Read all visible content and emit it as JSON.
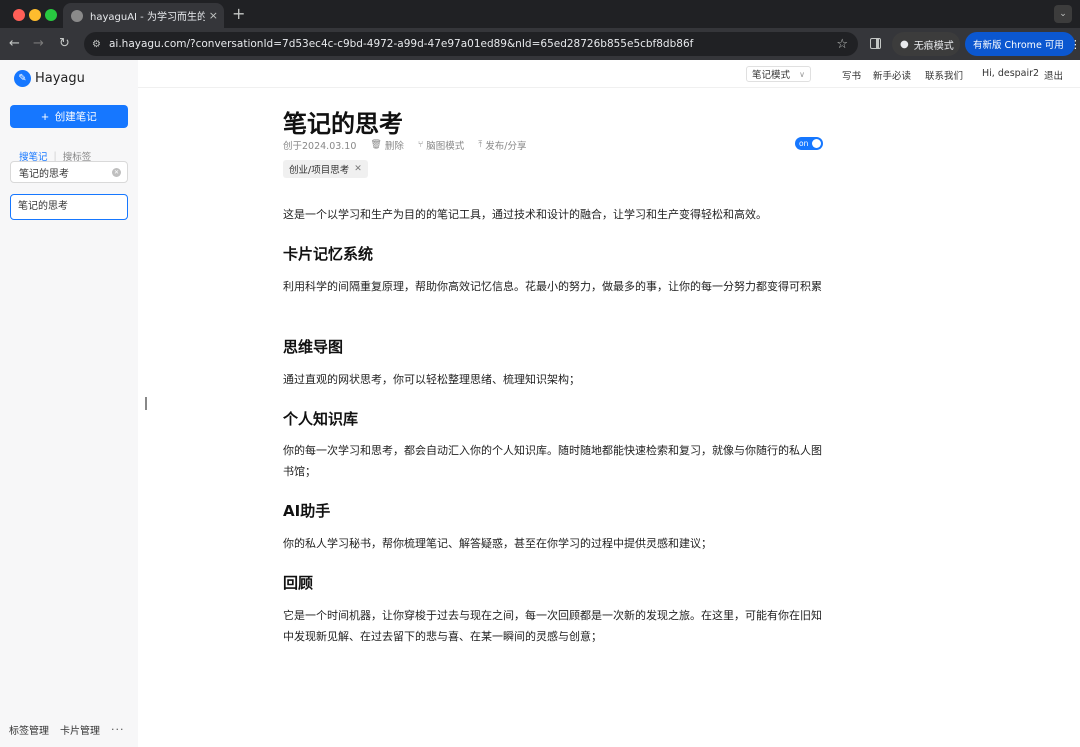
{
  "browser": {
    "tab_title": "hayaguAI - 为学习而生的笔记工具",
    "tab_close": "×",
    "new_tab": "+",
    "url": "ai.hayagu.com/?conversationId=7d53ec4c-c9bd-4972-a99d-47e97a01ed89&nId=65ed28726b855e5cbf8db86f",
    "incognito_label": "无痕模式",
    "update_label": "有新版 Chrome 可用"
  },
  "sidebar": {
    "brand": "Hayagu",
    "create_button": "创建笔记",
    "search_tabs": [
      "搜笔记",
      "搜标签"
    ],
    "search_value": "笔记的思考",
    "results": [
      "笔记的思考"
    ],
    "footer": {
      "tags": "标签管理",
      "cards": "卡片管理",
      "more": "···"
    }
  },
  "topnav": {
    "mode": "笔记模式",
    "write": "写书",
    "guide": "新手必读",
    "contact": "联系我们",
    "user": "Hi, despair2",
    "logout": "退出"
  },
  "note": {
    "title": "笔记的思考",
    "created": "创于2024.03.10",
    "delete": "删除",
    "mindmap": "脑图模式",
    "publish": "发布/分享",
    "toggle": "on",
    "tag": "创业/项目思考",
    "intro": "这是一个以学习和生产为目的的笔记工具，通过技术和设计的融合，让学习和生产变得轻松和高效。",
    "sections": [
      {
        "heading": "卡片记忆系统",
        "text": "利用科学的间隔重复原理，帮助你高效记忆信息。花最小的努力，做最多的事，让你的每一分努力都变得可积累"
      },
      {
        "heading": "思维导图",
        "text": "通过直观的网状思考，你可以轻松整理思绪、梳理知识架构；"
      },
      {
        "heading": "个人知识库",
        "text": "你的每一次学习和思考，都会自动汇入你的个人知识库。随时随地都能快速检索和复习，就像与你随行的私人图书馆；"
      },
      {
        "heading": "AI助手",
        "text": "你的私人学习秘书，帮你梳理笔记、解答疑惑，甚至在你学习的过程中提供灵感和建议；"
      },
      {
        "heading": "回顾",
        "text": "它是一个时间机器，让你穿梭于过去与现在之间，每一次回顾都是一次新的发现之旅。在这里，可能有你在旧知中发现新见解、在过去留下的悲与喜、在某一瞬间的灵感与创意；"
      }
    ]
  }
}
